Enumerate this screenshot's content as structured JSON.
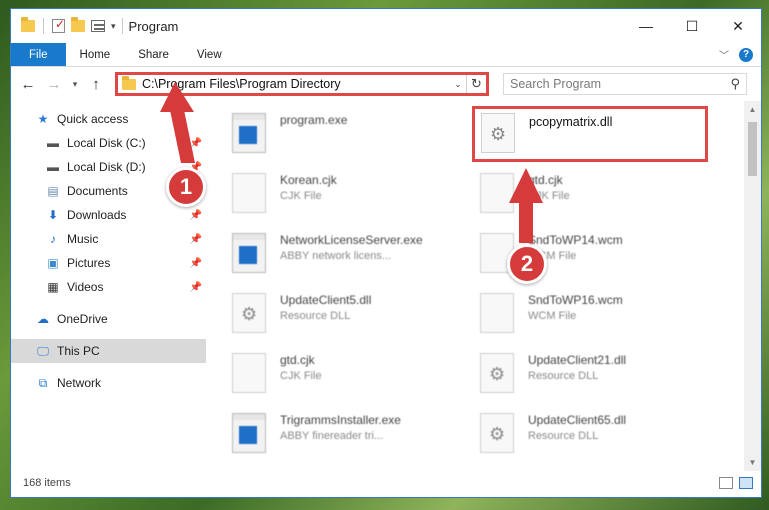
{
  "titlebar": {
    "title": "Program",
    "controls": {
      "minimize": "—",
      "maximize": "☐",
      "close": "✕"
    }
  },
  "ribbon": {
    "tabs": [
      {
        "label": "File"
      },
      {
        "label": "Home"
      },
      {
        "label": "Share"
      },
      {
        "label": "View"
      }
    ],
    "help": "?"
  },
  "address": {
    "path": "C:\\Program Files\\Program Directory",
    "search_placeholder": "Search Program"
  },
  "sidebar": {
    "items": [
      {
        "label": "Quick access",
        "icon": "star-icon"
      },
      {
        "label": "Local Disk (C:)",
        "icon": "drive-icon",
        "pinned": true
      },
      {
        "label": "Local Disk (D:)",
        "icon": "drive-icon",
        "pinned": true
      },
      {
        "label": "Documents",
        "icon": "documents-icon",
        "pinned": true
      },
      {
        "label": "Downloads",
        "icon": "download-icon",
        "pinned": true
      },
      {
        "label": "Music",
        "icon": "music-icon",
        "pinned": true
      },
      {
        "label": "Pictures",
        "icon": "pictures-icon",
        "pinned": true
      },
      {
        "label": "Videos",
        "icon": "video-icon",
        "pinned": true
      },
      {
        "label": "OneDrive",
        "icon": "cloud-icon"
      },
      {
        "label": "This PC",
        "icon": "monitor-icon",
        "selected": true
      },
      {
        "label": "Network",
        "icon": "network-icon"
      }
    ]
  },
  "files": {
    "left_column": [
      {
        "name": "program.exe",
        "type": "",
        "icon": "exe"
      },
      {
        "name": "Korean.cjk",
        "type": "CJK File",
        "icon": "blank"
      },
      {
        "name": "NetworkLicenseServer.exe",
        "type": "ABBY network licens...",
        "icon": "exe"
      },
      {
        "name": "UpdateClient5.dll",
        "type": "Resource DLL",
        "icon": "dll"
      },
      {
        "name": "gtd.cjk",
        "type": "CJK File",
        "icon": "blank"
      },
      {
        "name": "TrigrammsInstaller.exe",
        "type": "ABBY finereader tri...",
        "icon": "exe"
      }
    ],
    "right_column": [
      {
        "name": "pcopymatrix.dll",
        "type": "",
        "icon": "dll",
        "highlighted": true
      },
      {
        "name": "gtd.cjk",
        "type": "CJK File",
        "icon": "blank"
      },
      {
        "name": "SndToWP14.wcm",
        "type": "WCM File",
        "icon": "blank"
      },
      {
        "name": "SndToWP16.wcm",
        "type": "WCM File",
        "icon": "blank"
      },
      {
        "name": "UpdateClient21.dll",
        "type": "Resource DLL",
        "icon": "dll"
      },
      {
        "name": "UpdateClient65.dll",
        "type": "Resource DLL",
        "icon": "dll"
      }
    ]
  },
  "statusbar": {
    "count": "168 items"
  },
  "annotations": {
    "badge1": "1",
    "badge2": "2",
    "color": "#d63b3b"
  }
}
